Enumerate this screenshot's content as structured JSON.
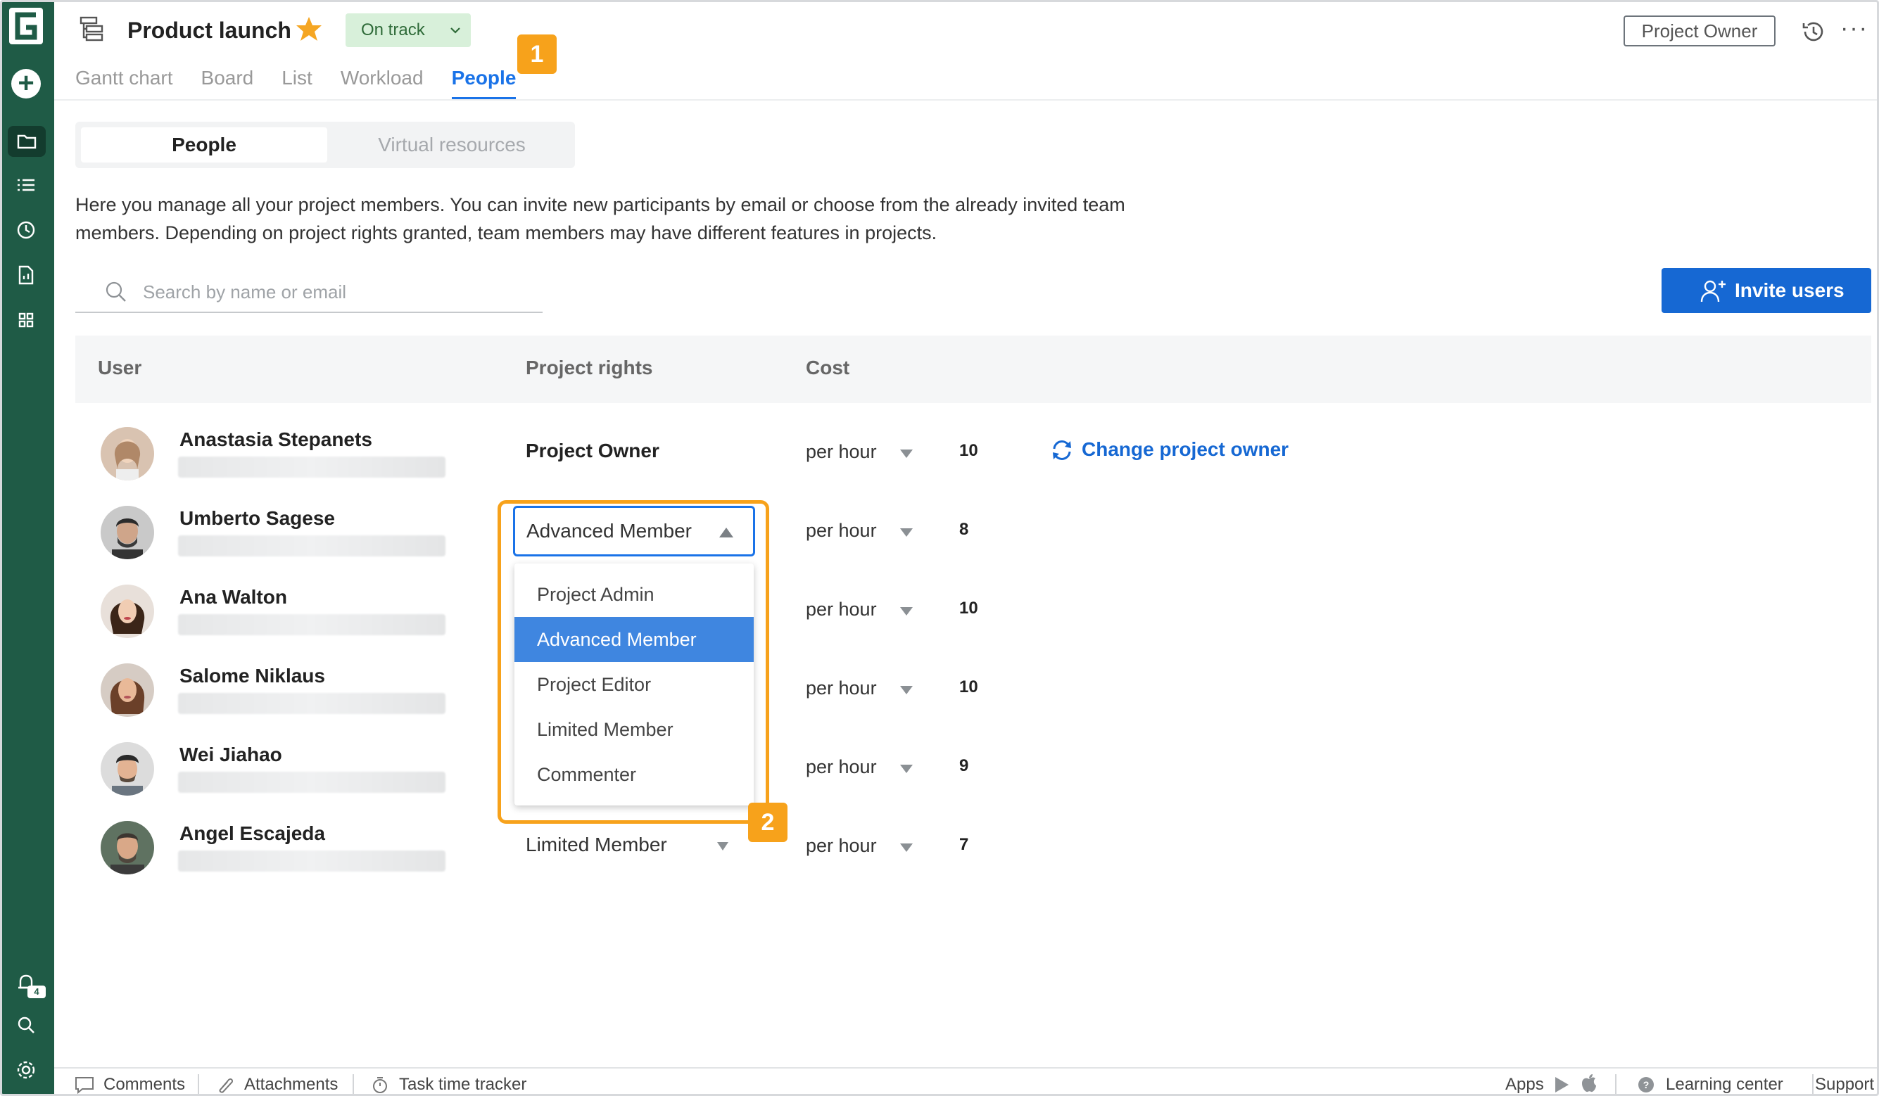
{
  "header": {
    "project_title": "Product launch",
    "status": "On track",
    "owner_button": "Project Owner",
    "more": "···"
  },
  "tabs": [
    {
      "label": "Gantt chart"
    },
    {
      "label": "Board"
    },
    {
      "label": "List"
    },
    {
      "label": "Workload"
    },
    {
      "label": "People",
      "active": true
    }
  ],
  "callouts": [
    "1",
    "2"
  ],
  "subtabs": [
    "People",
    "Virtual resources"
  ],
  "description": "Here you manage all your project members. You can invite new participants by email or choose from the already invited team members. Depending on project rights granted, team members may have different features in projects.",
  "search": {
    "placeholder": "Search by name or email",
    "value": ""
  },
  "invite_button": "Invite users",
  "table": {
    "columns": [
      "User",
      "Project rights",
      "Cost"
    ],
    "rows": [
      {
        "name": "Anastasia Stepanets",
        "rights": "Project Owner",
        "rate": "per hour",
        "cost": "10",
        "action": "Change project owner"
      },
      {
        "name": "Umberto Sagese",
        "rights": "Advanced Member",
        "rate": "per hour",
        "cost": "8"
      },
      {
        "name": "Ana Walton",
        "rights": "",
        "rate": "per hour",
        "cost": "10"
      },
      {
        "name": "Salome Niklaus",
        "rights": "",
        "rate": "per hour",
        "cost": "10"
      },
      {
        "name": "Wei Jiahao",
        "rights": "",
        "rate": "per hour",
        "cost": "9"
      },
      {
        "name": "Angel Escajeda",
        "rights": "Limited Member",
        "rate": "per hour",
        "cost": "7"
      }
    ]
  },
  "dropdown": {
    "selected": "Advanced Member",
    "options": [
      "Project Admin",
      "Advanced Member",
      "Project Editor",
      "Limited Member",
      "Commenter"
    ]
  },
  "sidebar": {
    "notifications_count": "4"
  },
  "footer": {
    "comments": "Comments",
    "attachments": "Attachments",
    "tracker": "Task time tracker",
    "apps": "Apps",
    "learning": "Learning center",
    "support": "Support"
  },
  "colors": {
    "rail": "#1f5b46",
    "accent": "#1a73e8",
    "callout": "#f7a21b",
    "status_bg": "#d8f0da",
    "invite_bg": "#1668d3"
  }
}
